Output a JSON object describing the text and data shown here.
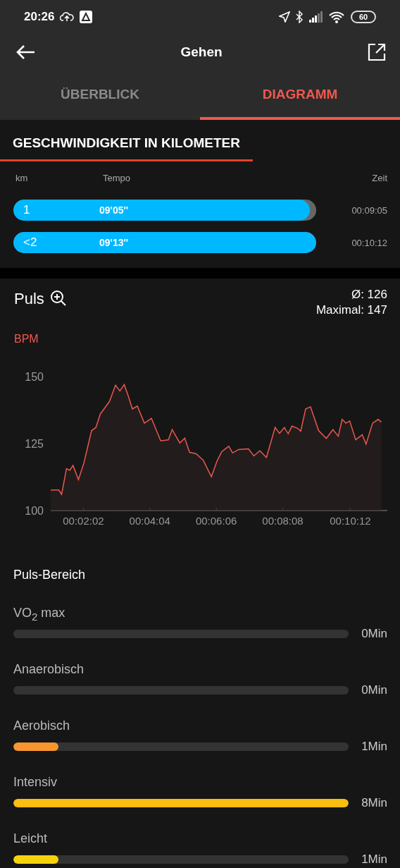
{
  "status_bar": {
    "time": "20:26",
    "battery": "60"
  },
  "app_bar": {
    "title": "Gehen"
  },
  "tabs": [
    {
      "label": "ÜBERBLICK",
      "selected": false
    },
    {
      "label": "DIAGRAMM",
      "selected": true
    }
  ],
  "speed": {
    "title": "GESCHWINDIGKEIT IN KILOMETER",
    "columns": [
      "km",
      "Tempo",
      "Zeit"
    ],
    "rows": [
      {
        "km": "1",
        "tempo": "09'05''",
        "time": "00:09:05",
        "level": 0.98
      },
      {
        "km": "<2",
        "tempo": "09'13''",
        "time": "00:10:12",
        "level": 1
      }
    ]
  },
  "pulse": {
    "title": "Puls",
    "average": "Ø: 126",
    "maximum": "Maximal: 147",
    "chart_data": {
      "type": "area",
      "ylabel": "BPM",
      "xlim": [
        62,
        680
      ],
      "ylim": [
        100,
        150
      ],
      "xticks": [
        {
          "value": 122,
          "label": "00:02:02"
        },
        {
          "value": 244,
          "label": "00:04:04"
        },
        {
          "value": 366,
          "label": "00:06:06"
        },
        {
          "value": 488,
          "label": "00:08:08"
        },
        {
          "value": 612,
          "label": "00:10:12"
        }
      ],
      "yticks": [
        100,
        125,
        150
      ],
      "x": [
        62,
        77,
        82,
        91,
        97,
        103,
        113,
        123,
        137,
        145,
        153,
        170,
        181,
        189,
        197,
        204,
        212,
        221,
        234,
        247,
        264,
        278,
        285,
        299,
        308,
        317,
        329,
        342,
        357,
        367,
        376,
        389,
        396,
        407,
        425,
        435,
        446,
        458,
        474,
        482,
        491,
        498,
        505,
        515,
        521,
        530,
        539,
        554,
        568,
        580,
        590,
        597,
        604,
        611,
        622,
        634,
        641,
        653,
        663,
        669
      ],
      "series": [
        {
          "color": "#e8584e",
          "values": [
            107.6,
            107.6,
            106,
            115.6,
            115,
            116.8,
            111.5,
            117.8,
            129.8,
            131,
            136,
            140.7,
            146.8,
            144.6,
            147,
            143,
            137.9,
            139,
            132.6,
            134.4,
            126,
            126.4,
            130.2,
            125.2,
            127,
            121.7,
            121.2,
            118.8,
            112.6,
            118.3,
            122,
            124,
            121.5,
            122.8,
            123,
            120.4,
            122.3,
            119.8,
            131,
            128.8,
            131,
            128.6,
            131.5,
            130.7,
            129.6,
            137.9,
            138.7,
            129.8,
            126.9,
            130.2,
            127.7,
            134,
            132.6,
            133.4,
            126.4,
            128.3,
            124.8,
            132.6,
            134,
            133
          ]
        }
      ]
    }
  },
  "zones": {
    "title": "Puls-Bereich",
    "items": [
      {
        "name": "VO$_{2}$ max",
        "value": "0Min"
      },
      {
        "name": "Anaerobisch",
        "value": "0Min"
      },
      {
        "name": "Aerobisch",
        "value": "1Min",
        "level": 0.135,
        "color": "#f7952f"
      },
      {
        "name": "Intensiv",
        "value": "8Min",
        "level": 1,
        "color": "#f9be0f"
      },
      {
        "name": "Leicht",
        "value": "1Min",
        "level": 0.135,
        "color": "#f4d30c"
      }
    ]
  }
}
